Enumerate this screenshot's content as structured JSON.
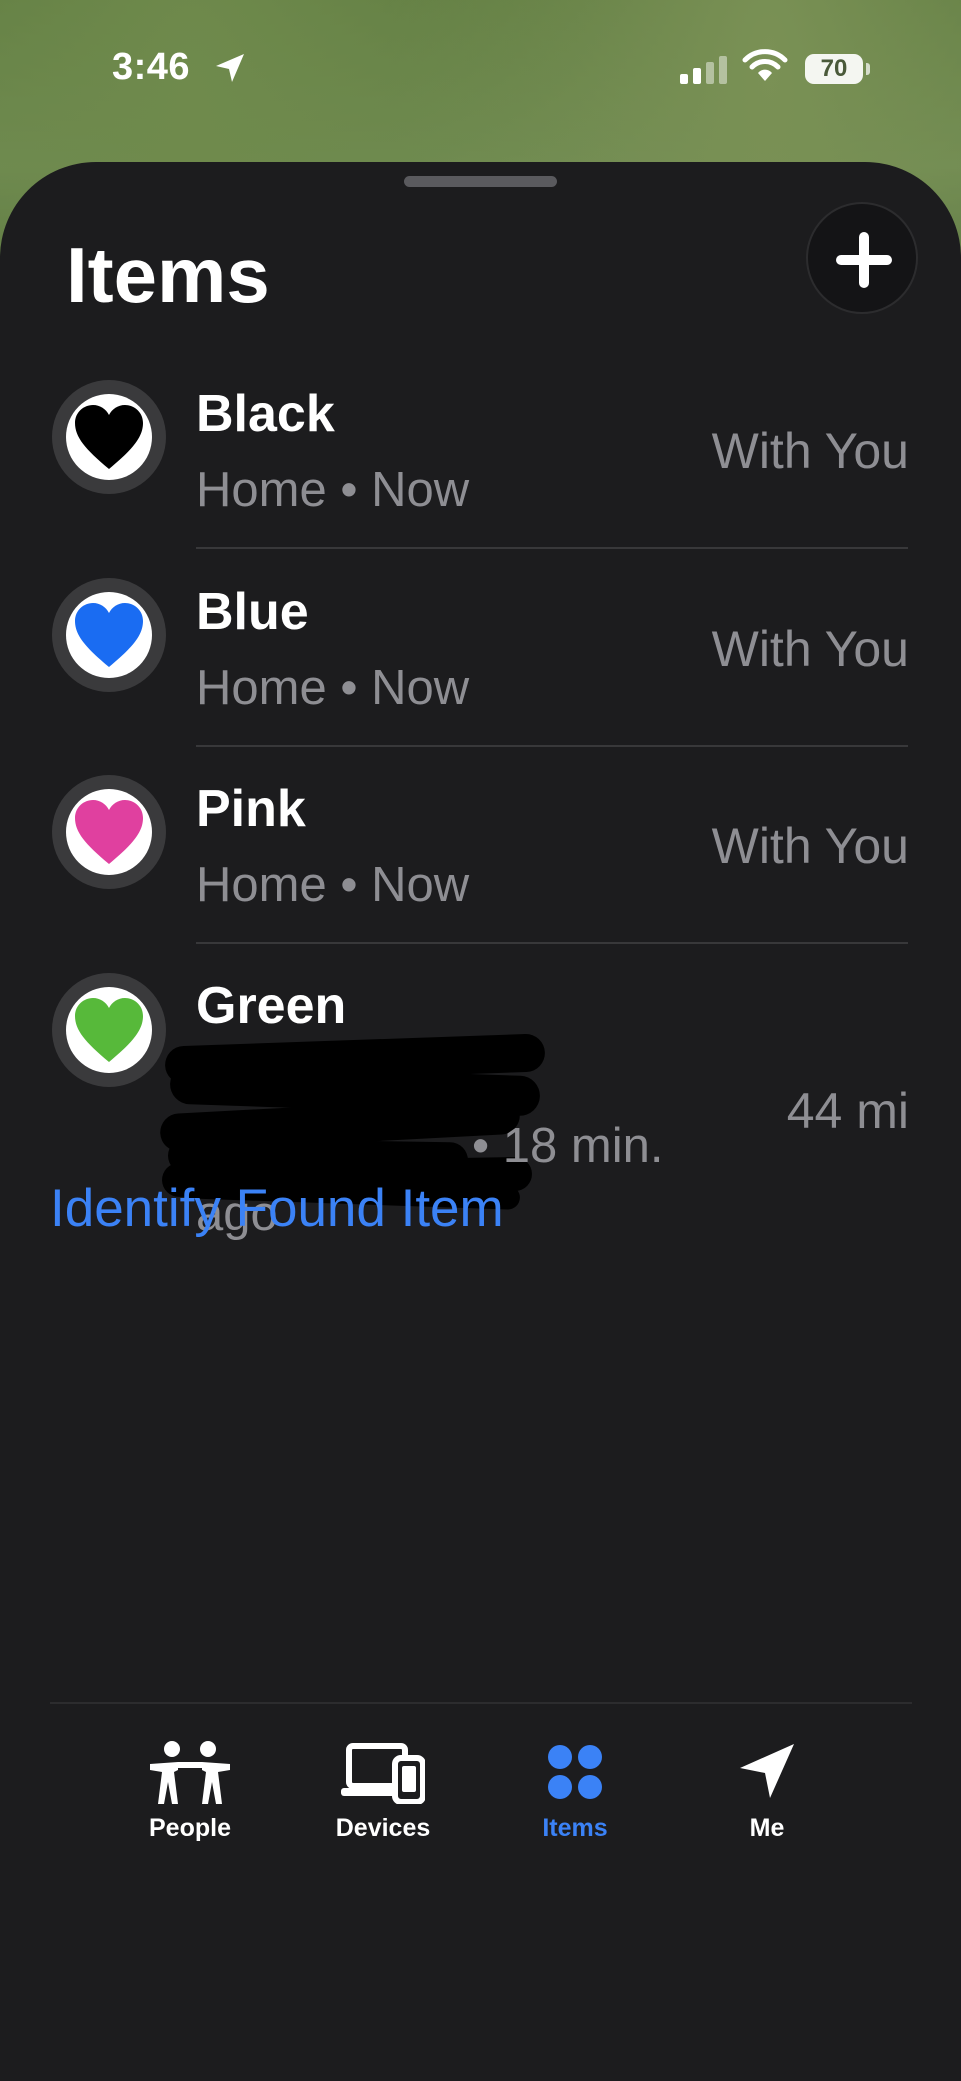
{
  "status_bar": {
    "time": "3:46",
    "battery": "70"
  },
  "sheet": {
    "title": "Items"
  },
  "items": [
    {
      "name": "Black",
      "subtitle": "Home • Now",
      "status": "With You",
      "color": "#000000",
      "icon": "black-heart-icon"
    },
    {
      "name": "Blue",
      "subtitle": "Home • Now",
      "status": "With You",
      "color": "#1a6cf2",
      "icon": "blue-heart-icon"
    },
    {
      "name": "Pink",
      "subtitle": "Home • Now",
      "status": "With You",
      "color": "#e0409f",
      "icon": "pink-heart-icon"
    },
    {
      "name": "Green",
      "subtitle_suffix": "• 18 min.",
      "subtitle_line3": "ago",
      "status": "44 mi",
      "color": "#57b93a",
      "icon": "green-heart-icon"
    }
  ],
  "identify_link": "Identify Found Item",
  "tabs": [
    {
      "label": "People",
      "icon": "people-icon",
      "active": false
    },
    {
      "label": "Devices",
      "icon": "devices-icon",
      "active": false
    },
    {
      "label": "Items",
      "icon": "items-icon",
      "active": true
    },
    {
      "label": "Me",
      "icon": "location-arrow-icon",
      "active": false
    }
  ],
  "colors": {
    "accent": "#3b82f6",
    "sheet_background": "#1c1c1e",
    "secondary_text": "#8e8e93"
  }
}
